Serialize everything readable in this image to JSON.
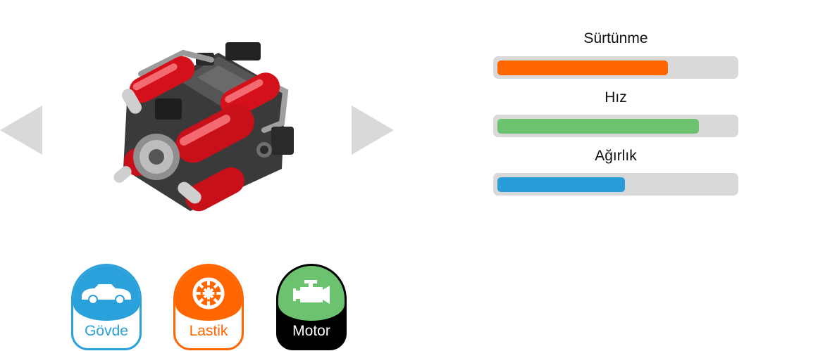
{
  "stats": [
    {
      "label": "Sürtünme",
      "value": 0.72,
      "color": "#ff6600"
    },
    {
      "label": "Hız",
      "value": 0.85,
      "color": "#6dc26f"
    },
    {
      "label": "Ağırlık",
      "value": 0.54,
      "color": "#2a9cd8"
    }
  ],
  "tabs": {
    "govde": {
      "label": "Gövde",
      "icon": "car-icon",
      "color": "#2aa1db"
    },
    "lastik": {
      "label": "Lastik",
      "icon": "wheel-icon",
      "color": "#ff6600"
    },
    "motor": {
      "label": "Motor",
      "icon": "engine-icon",
      "color": "#6dc26f",
      "selected": true
    }
  },
  "preview": {
    "icon": "engine-part-image"
  },
  "arrows": {
    "left_icon": "arrow-left-icon",
    "right_icon": "arrow-right-icon",
    "color": "#d9d9d9"
  }
}
